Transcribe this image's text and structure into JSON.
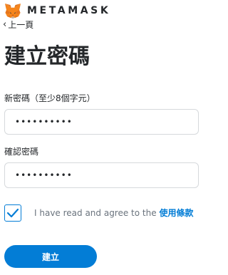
{
  "brand": {
    "logo_icon": "metamask-fox-icon",
    "wordmark": "METAMASK"
  },
  "nav": {
    "back_icon": "chevron-left-icon",
    "back_label": "上一頁"
  },
  "page": {
    "title": "建立密碼"
  },
  "form": {
    "new_password": {
      "label": "新密碼（至少8個字元）",
      "value": "••••••••••"
    },
    "confirm_password": {
      "label": "確認密碼",
      "value": "••••••••••"
    },
    "terms": {
      "checked": true,
      "text": "I have read and agree to the ",
      "link_text": "使用條款"
    },
    "submit_label": "建立"
  },
  "colors": {
    "primary": "#037dd6",
    "text": "#24272a",
    "muted_text": "#6a737d",
    "field_border": "#d6d9dc",
    "background": "#ffffff"
  }
}
